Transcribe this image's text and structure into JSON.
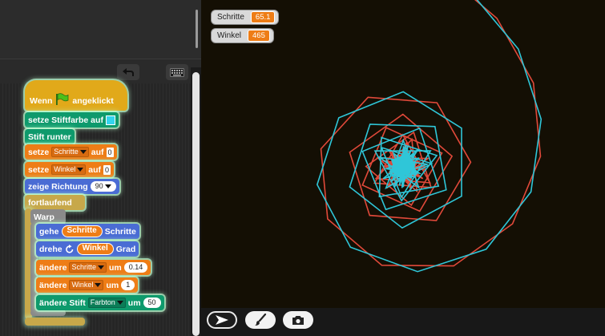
{
  "scripts": {
    "hat": {
      "label": "Wenn",
      "label2": "angeklickt"
    },
    "set_pen_color": {
      "label": "setze Stiftfarbe auf",
      "color": "#33d4ee"
    },
    "pen_down": {
      "label": "Stift runter"
    },
    "set_schritte": {
      "label": "setze",
      "var": "Schritte",
      "to": "auf",
      "value": "0"
    },
    "set_winkel": {
      "label": "setze",
      "var": "Winkel",
      "to": "auf",
      "value": "0"
    },
    "point_dir": {
      "label": "zeige Richtung",
      "value": "90"
    },
    "forever": {
      "label": "fortlaufend"
    },
    "warp": {
      "label": "Warp"
    },
    "move": {
      "label": "gehe",
      "var": "Schritte",
      "suffix": "Schritte"
    },
    "turn": {
      "label": "drehe",
      "var": "Winkel",
      "suffix": "Grad"
    },
    "change_schritte": {
      "label": "ändere",
      "var": "Schritte",
      "by": "um",
      "value": "0.14"
    },
    "change_winkel": {
      "label": "ändere",
      "var": "Winkel",
      "by": "um",
      "value": "1"
    },
    "change_pen": {
      "label": "ändere Stift",
      "param": "Farbton",
      "by": "um",
      "value": "50"
    }
  },
  "watchers": [
    {
      "name": "Schritte",
      "value": "65.1"
    },
    {
      "name": "Winkel",
      "value": "465"
    }
  ],
  "stage": {
    "background": "#140f04",
    "pen_colors": [
      "#e1493a",
      "#2fc6d8"
    ]
  },
  "icons": {
    "undo": "undo-icon",
    "keyboard": "keyboard-icon",
    "flag": "green-flag-icon",
    "turn": "turn-clockwise-icon",
    "pointer": "pointer-icon",
    "brush": "brush-icon",
    "camera": "camera-icon"
  }
}
